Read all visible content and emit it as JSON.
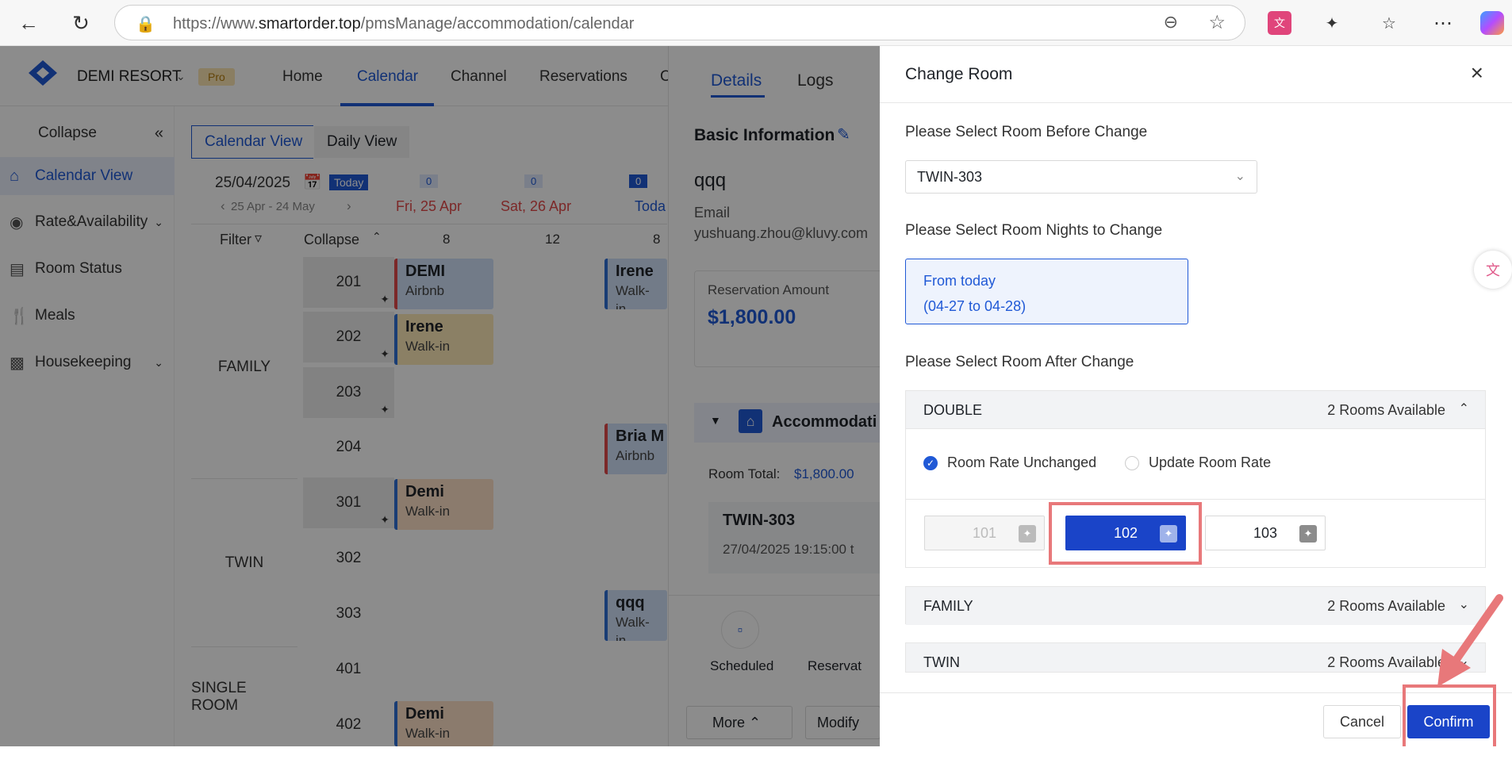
{
  "browser": {
    "url_prefix": "https://www.",
    "url_domain": "smartorder.top",
    "url_path": "/pmsManage/accommodation/calendar"
  },
  "app": {
    "brand": "DEMI RESORT",
    "pro_badge": "Pro",
    "nav": [
      "Home",
      "Calendar",
      "Channel",
      "Reservations",
      "C"
    ],
    "sidebar": {
      "collapse": "Collapse",
      "items": [
        "Calendar View",
        "Rate&Availability",
        "Room Status",
        "Meals",
        "Housekeeping"
      ]
    },
    "view_tabs": [
      "Calendar View",
      "Daily View"
    ],
    "calendar": {
      "date": "25/04/2025",
      "today_badge": "Today",
      "range": "25 Apr - 24 May",
      "filter": "Filter",
      "collapse": "Collapse",
      "days": [
        {
          "label": "Fri, 25 Apr",
          "count": "0",
          "avail": "8"
        },
        {
          "label": "Sat, 26 Apr",
          "count": "0",
          "avail": "12"
        },
        {
          "label": "Toda",
          "count": "0",
          "avail": "8"
        }
      ],
      "categories": [
        "FAMILY",
        "TWIN",
        "SINGLE ROOM"
      ],
      "rooms": [
        "201",
        "202",
        "203",
        "204",
        "301",
        "302",
        "303",
        "401",
        "402"
      ],
      "bookings": [
        {
          "name": "DEMI",
          "source": "Airbnb"
        },
        {
          "name": "Irene",
          "source": "Walk-in"
        },
        {
          "name": "Demi",
          "source": "Walk-in"
        },
        {
          "name": "Demi",
          "source": "Walk-in"
        },
        {
          "name": "Irene",
          "source": "Walk-in"
        },
        {
          "name": "Bria M",
          "source": "Airbnb"
        },
        {
          "name": "qqq",
          "source": "Walk-in"
        }
      ]
    },
    "detail": {
      "tabs": [
        "Details",
        "Logs"
      ],
      "section": "Basic Information",
      "guest": "qqq",
      "email_label": "Email",
      "email": "yushuang.zhou@kluvy.com",
      "amount_label": "Reservation Amount",
      "amount": "$1,800.00",
      "accommodation": "Accommodati",
      "room_total_label": "Room Total:",
      "room_total": "$1,800.00",
      "room": "TWIN-303",
      "checkin": "27/04/2025 19:15:00 t",
      "scheduled": "Scheduled",
      "reservat": "Reservat",
      "more": "More",
      "modify": "Modify"
    }
  },
  "modal": {
    "title": "Change Room",
    "before_label": "Please Select Room Before Change",
    "before_value": "TWIN-303",
    "nights_label": "Please Select Room Nights to Change",
    "nights_line1": "From today",
    "nights_line2": "(04-27 to 04-28)",
    "after_label": "Please Select Room After Change",
    "groups": [
      {
        "name": "DOUBLE",
        "available": "2 Rooms Available"
      },
      {
        "name": "FAMILY",
        "available": "2 Rooms Available"
      },
      {
        "name": "TWIN",
        "available": "2 Rooms Available"
      }
    ],
    "rate_unchanged": "Room Rate Unchanged",
    "update_rate": "Update Room Rate",
    "rooms": [
      "101",
      "102",
      "103"
    ],
    "cancel": "Cancel",
    "confirm": "Confirm"
  },
  "colors": {
    "accent": "#1a44c8",
    "highlight": "#e8787a"
  }
}
